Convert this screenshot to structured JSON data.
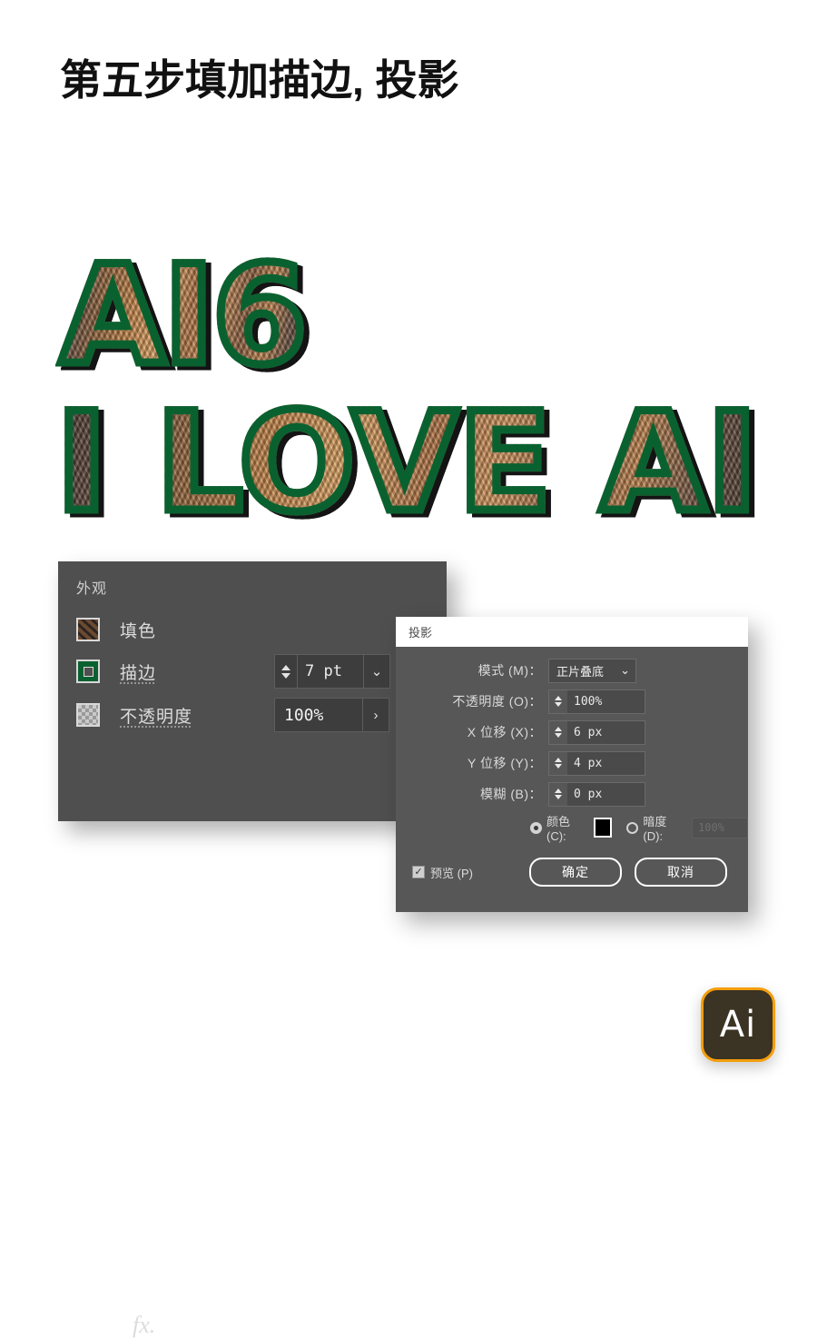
{
  "page": {
    "title": "第五步填加描边, 投影"
  },
  "artwork": {
    "line1": "AI6",
    "line2": "I LOVE AI",
    "stroke_color": "#0a6130",
    "shadow_color": "#000000"
  },
  "appearance_panel": {
    "title": "外观",
    "rows": [
      {
        "label": "填色",
        "swatch": "image-thumbnail-swatch"
      },
      {
        "label": "描边",
        "swatch": "green-stroke-swatch",
        "value": "7 pt"
      },
      {
        "label": "不透明度",
        "swatch": "checkerboard-swatch",
        "value": "100%"
      }
    ],
    "fx_label": "fx."
  },
  "shadow_dialog": {
    "title": "投影",
    "fields": [
      {
        "label": "模式 (M)：",
        "value": "正片叠底",
        "type": "select"
      },
      {
        "label": "不透明度 (O)：",
        "value": "100%",
        "type": "stepper"
      },
      {
        "label": "X 位移 (X)：",
        "value": "6 px",
        "type": "stepper"
      },
      {
        "label": "Y 位移 (Y)：",
        "value": "4 px",
        "type": "stepper"
      },
      {
        "label": "模糊 (B)：",
        "value": "0 px",
        "type": "stepper"
      }
    ],
    "color_option": {
      "color_label": "颜色 (C):",
      "color_value": "#000000",
      "darkness_label": "暗度 (D):",
      "darkness_value": "100%"
    },
    "preview_label": "预览 (P)",
    "preview_checked": "✓",
    "ok_label": "确定",
    "cancel_label": "取消"
  },
  "ai_badge": {
    "text": "Ai",
    "border_color": "#f49e0b",
    "background_color": "#3b3323"
  }
}
